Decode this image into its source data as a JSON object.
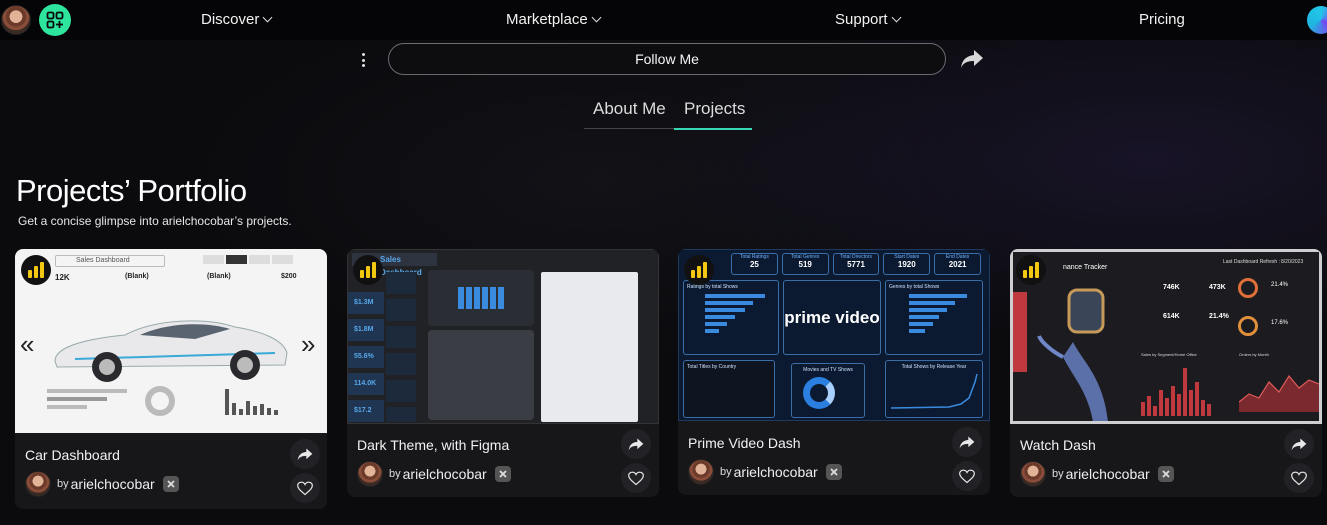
{
  "nav": {
    "links": [
      {
        "label": "Discover",
        "has_dropdown": true
      },
      {
        "label": "Marketplace",
        "has_dropdown": true
      },
      {
        "label": "Support",
        "has_dropdown": true
      },
      {
        "label": "Pricing",
        "has_dropdown": false
      }
    ],
    "apps_icon": "apps-plus-icon",
    "accent": "#2ee59d"
  },
  "profile_bar": {
    "follow_label": "Follow Me",
    "more_icon": "kebab-menu-icon",
    "share_icon": "share-arrow-icon"
  },
  "tabs": [
    {
      "label": "About Me",
      "active": false
    },
    {
      "label": "Projects",
      "active": true
    }
  ],
  "tab_accent": "#37d8b6",
  "portfolio": {
    "title": "Projects’ Portfolio",
    "subtitle": "Get a concise glimpse into arielchocobar’s projects."
  },
  "cards": [
    {
      "title": "Car Dashboard",
      "by": "by",
      "author": "arielchocobar",
      "badge_icon": "power-bi-icon",
      "thumb": {
        "header": "Sales Dashboard",
        "kpis": [
          "12K",
          "(Blank)",
          "(Blank)",
          "$200"
        ],
        "prev_arrow": "«",
        "next_arrow": "»"
      }
    },
    {
      "title": "Dark Theme, with Figma",
      "by": "by",
      "author": "arielchocobar",
      "badge_icon": "power-bi-icon",
      "thumb": {
        "header": "Sales Dashboard",
        "kpis": [
          "$1.3M",
          "$1.8M",
          "55.6%",
          "114.0K",
          "$17.2"
        ]
      }
    },
    {
      "title": "Prime Video Dash",
      "by": "by",
      "author": "arielchocobar",
      "badge_icon": "power-bi-icon",
      "thumb": {
        "kpi_labels": [
          "Total Ratings",
          "Total Genres",
          "Total Directors",
          "Start Dates",
          "End Dates"
        ],
        "kpis": [
          "25",
          "519",
          "5771",
          "1920",
          "2021"
        ],
        "logo": "prime video",
        "panels": [
          "Ratings by total Shows",
          "Genres by total Shows",
          "Total Titles by Country",
          "Movies and TV Shows",
          "Total Shows by Release Year"
        ]
      }
    },
    {
      "title": "Watch Dash",
      "by": "by",
      "author": "arielchocobar",
      "badge_icon": "power-bi-icon",
      "thumb": {
        "header": "nance Tracker",
        "refresh": "Last Dashboard Refresh :",
        "date": "8/20/2023",
        "kpis": [
          "746K",
          "473K",
          "21.4%",
          "614K",
          "21.4%",
          "17.6%"
        ],
        "panels": [
          "Sales by Segment/Home Office",
          "Orders by Month"
        ]
      }
    }
  ]
}
